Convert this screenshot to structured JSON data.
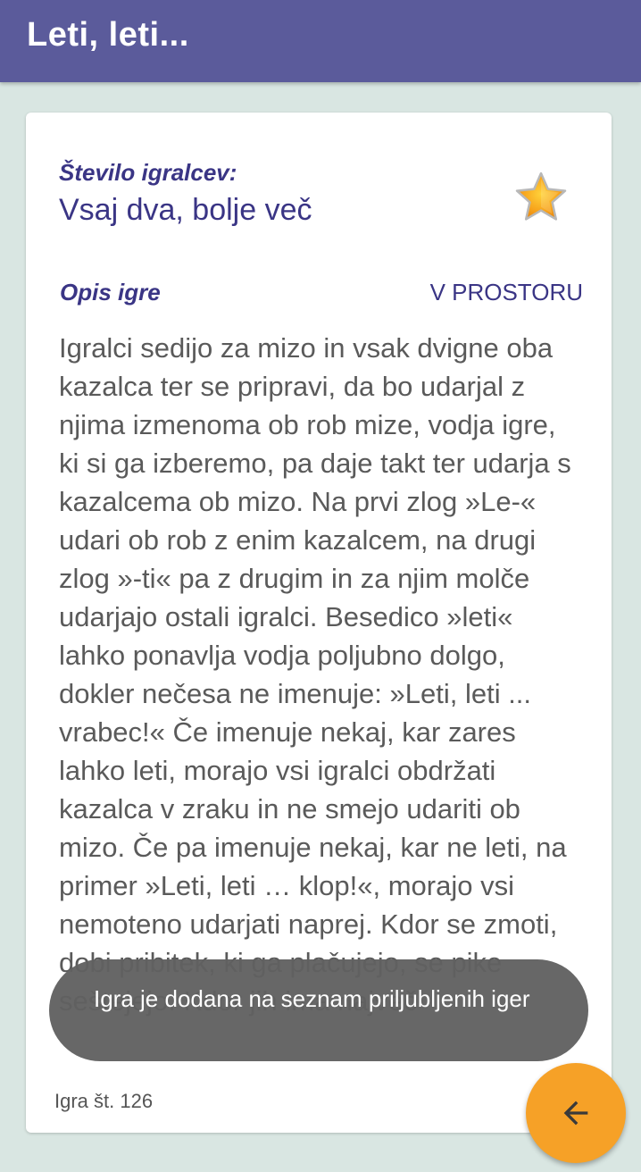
{
  "header": {
    "title": "Leti, leti..."
  },
  "card": {
    "players_label": "Število igralcev:",
    "players_value": "Vsaj dva, bolje več",
    "favorite_icon": "star-icon",
    "description_label": "Opis igre",
    "location": "V PROSTORU",
    "description": "Igralci sedijo za mizo in vsak dvigne oba kazalca ter se pripravi, da bo udarjal z njima izmenoma ob rob mize, vodja igre, ki si ga izberemo, pa daje takt ter udarja s kazalcema ob mizo. Na prvi zlog »Le-« udari ob rob z enim kazalcem, na drugi zlog »-ti« pa z drugim in za njim molče udarjajo ostali igralci. Besedico »leti« lahko ponavlja vodja poljubno dolgo, dokler nečesa ne imenuje: »Leti, leti ... vrabec!« Če imenuje nekaj, kar zares lahko leti, morajo vsi igralci obdržati kazalca v zraku in ne smejo udariti ob mizo. Če pa imenuje nekaj, kar ne leti, na primer »Leti, leti … klop!«, morajo vsi nemoteno udarjati naprej. Kdor se zmoti, dobi pribitek, ki ga plačujejo, se pike seštejejo. Kdor jih ima največ",
    "game_number": "Igra št. 126"
  },
  "toast": {
    "message": "Igra je dodana na seznam priljubljenih iger"
  },
  "fab": {
    "icon": "arrow-left-icon"
  },
  "colors": {
    "app_bar": "#5b5b9b",
    "background": "#d9e6e2",
    "accent_text": "#3a3585",
    "fab": "#f6a127",
    "star_fill": "#f7a21b"
  }
}
